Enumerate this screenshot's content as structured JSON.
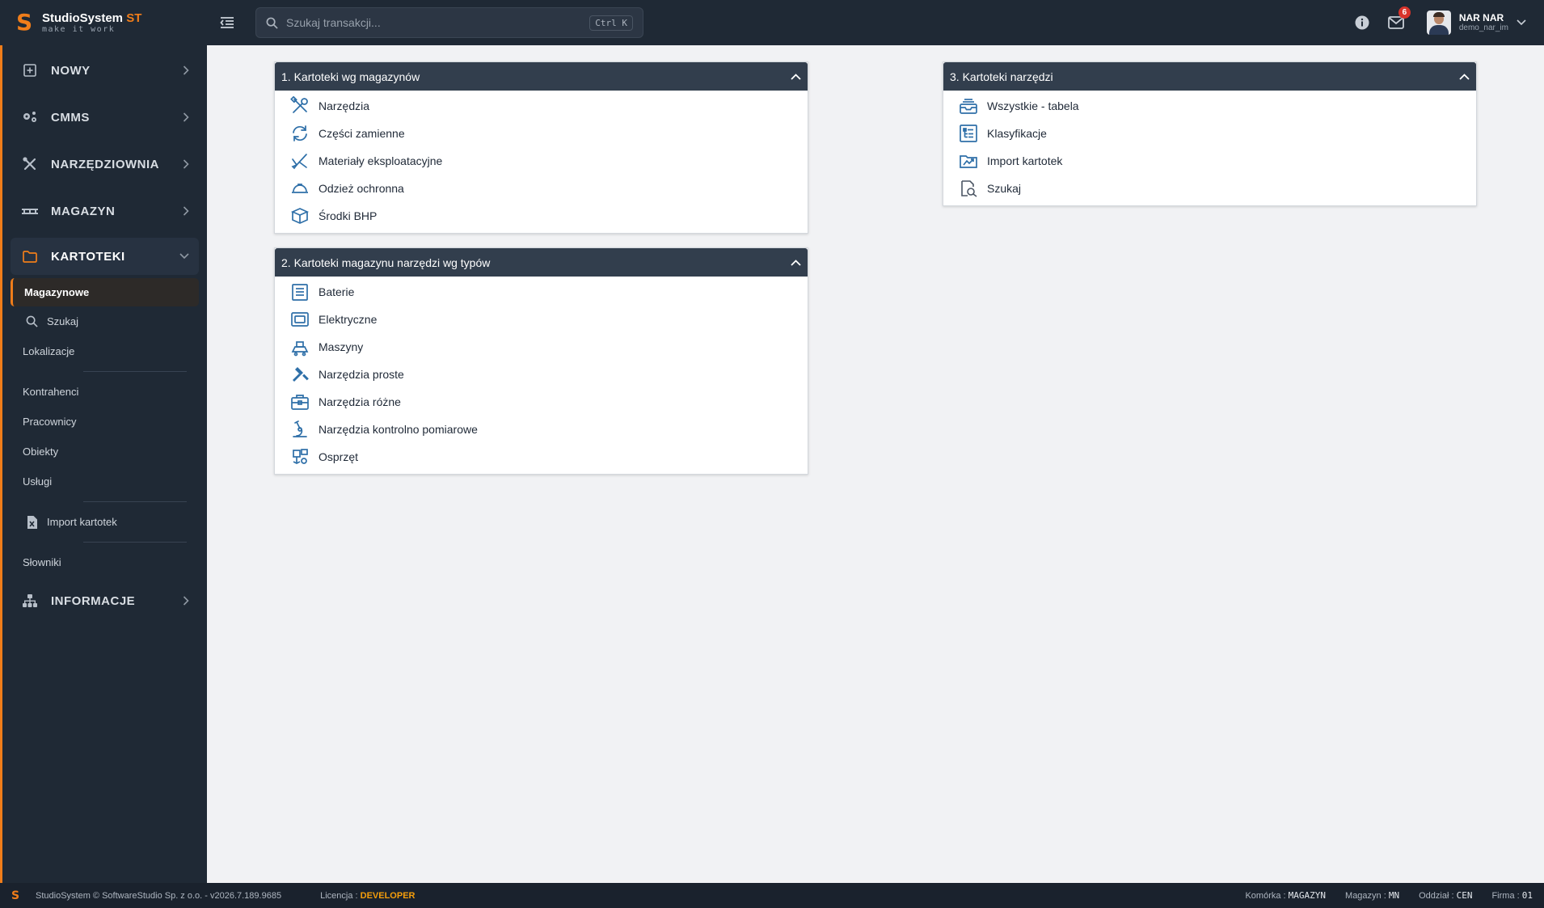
{
  "app": {
    "name": "StudioSystem",
    "name_suffix": "ST",
    "tagline": "make it work",
    "logo_letter": "S"
  },
  "topbar": {
    "search_placeholder": "Szukaj transakcji...",
    "search_shortcut": "Ctrl K",
    "notifications_count": "6",
    "user_name": "NAR NAR",
    "user_login": "demo_nar_im"
  },
  "sidebar": {
    "groups": {
      "nowy": "NOWY",
      "cmms": "CMMS",
      "narzedziownia": "NARZĘDZIOWNIA",
      "magazyn": "MAGAZYN",
      "kartoteki": "KARTOTEKI",
      "informacje": "INFORMACJE"
    },
    "kartoteki_items": {
      "magazynowe": "Magazynowe",
      "szukaj": "Szukaj",
      "lokalizacje": "Lokalizacje",
      "kontrahenci": "Kontrahenci",
      "pracownicy": "Pracownicy",
      "obiekty": "Obiekty",
      "uslugi": "Usługi",
      "import": "Import kartotek",
      "slowniki": "Słowniki"
    }
  },
  "panels": {
    "p1": {
      "title": "1. Kartoteki wg magazynów",
      "items": [
        "Narzędzia",
        "Części zamienne",
        "Materiały eksploatacyjne",
        "Odzież ochronna",
        "Środki BHP"
      ]
    },
    "p2": {
      "title": "2. Kartoteki magazynu narzędzi wg typów",
      "items": [
        "Baterie",
        "Elektryczne",
        "Maszyny",
        "Narzędzia proste",
        "Narzędzia różne",
        "Narzędzia kontrolno pomiarowe",
        "Osprzęt"
      ]
    },
    "p3": {
      "title": "3. Kartoteki narzędzi",
      "items": [
        "Wszystkie - tabela",
        "Klasyfikacje",
        "Import kartotek",
        "Szukaj"
      ]
    }
  },
  "footer": {
    "logo_letter": "S",
    "copyright": "StudioSystem © SoftwareStudio Sp. z o.o. - v2026.7.189.9685",
    "license_label": "Licencja :",
    "license_value": "DEVELOPER",
    "komorka_label": "Komórka :",
    "komorka_value": "MAGAZYN",
    "magazyn_label": "Magazyn :",
    "magazyn_value": "MN",
    "oddzial_label": "Oddział :",
    "oddzial_value": "CEN",
    "firma_label": "Firma :",
    "firma_value": "01"
  },
  "colors": {
    "accent": "#f07d1a",
    "sidebar_bg": "#1f2935",
    "panel_header": "#323e4d",
    "icon_blue": "#2e6fa8"
  }
}
